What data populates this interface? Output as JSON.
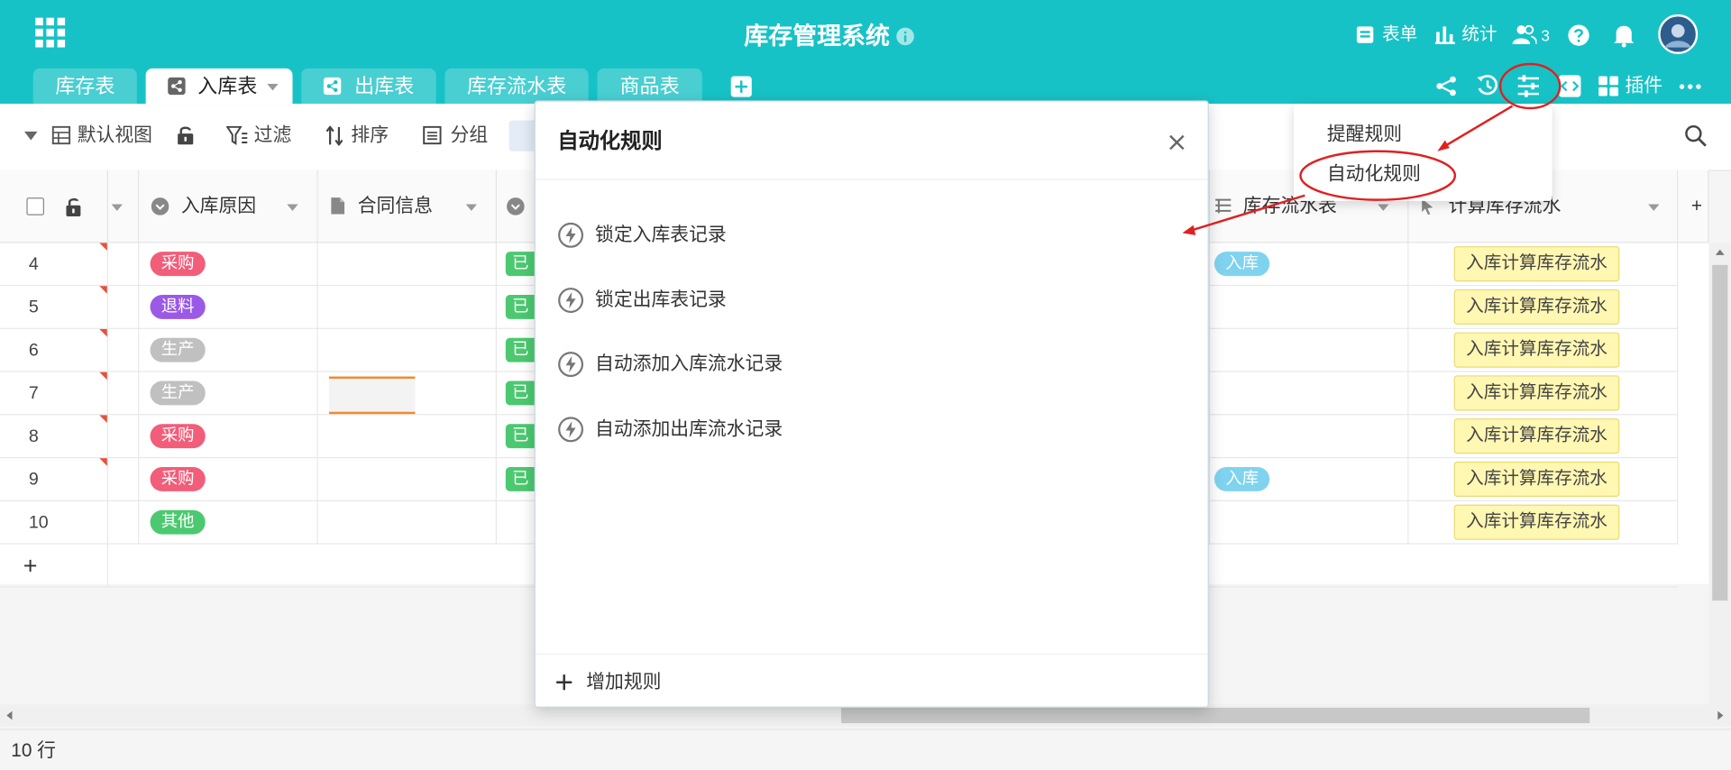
{
  "app": {
    "title": "库存管理系统"
  },
  "header": {
    "form_label": "表单",
    "stats_label": "统计",
    "members_count": "3"
  },
  "tabs": [
    {
      "label": "库存表"
    },
    {
      "label": "入库表"
    },
    {
      "label": "出库表"
    },
    {
      "label": "库存流水表"
    },
    {
      "label": "商品表"
    }
  ],
  "right_tools": {
    "plugins_label": "插件"
  },
  "toolbar": {
    "view_label": "默认视图",
    "filter_label": "过滤",
    "sort_label": "排序",
    "group_label": "分组"
  },
  "grid": {
    "columns": [
      {
        "label": "入库原因"
      },
      {
        "label": "合同信息"
      },
      {
        "label": "库存流水表"
      },
      {
        "label": "计算库存流水"
      }
    ],
    "rows": [
      {
        "num": "4",
        "reason": "采购",
        "reason_color": "#f25d7a",
        "flow": "入库",
        "calc": "入库计算库存流水"
      },
      {
        "num": "5",
        "reason": "退料",
        "reason_color": "#9b59e6",
        "flow": "",
        "calc": "入库计算库存流水"
      },
      {
        "num": "6",
        "reason": "生产",
        "reason_color": "#c0c0c0",
        "flow": "",
        "calc": "入库计算库存流水"
      },
      {
        "num": "7",
        "reason": "生产",
        "reason_color": "#c0c0c0",
        "flow": "",
        "calc": "入库计算库存流水"
      },
      {
        "num": "8",
        "reason": "采购",
        "reason_color": "#f25d7a",
        "flow": "",
        "calc": "入库计算库存流水"
      },
      {
        "num": "9",
        "reason": "采购",
        "reason_color": "#f25d7a",
        "flow": "入库",
        "calc": "入库计算库存流水"
      },
      {
        "num": "10",
        "reason": "其他",
        "reason_color": "#4cc970",
        "flow": "",
        "calc": "入库计算库存流水"
      }
    ],
    "partial_tag": "已",
    "add_row_symbol": "+"
  },
  "status": {
    "row_count": "10 行"
  },
  "modal": {
    "title": "自动化规则",
    "rules": [
      {
        "label": "锁定入库表记录"
      },
      {
        "label": "锁定出库表记录"
      },
      {
        "label": "自动添加入库流水记录"
      },
      {
        "label": "自动添加出库流水记录"
      }
    ],
    "add_label": "增加规则"
  },
  "dropdown": {
    "items": [
      {
        "label": "提醒规则"
      },
      {
        "label": "自动化规则"
      }
    ]
  },
  "colors": {
    "header_bg": "#17c2c6",
    "annotation_red": "#e02020",
    "flow_pill": "#7fd3ee",
    "calc_chip_bg": "#fff7b2"
  },
  "icons": [
    "apps-grid-icon",
    "info-icon",
    "form-icon",
    "bar-chart-icon",
    "users-icon",
    "help-icon",
    "bell-icon",
    "avatar",
    "share-icon",
    "history-icon",
    "settings-sliders-icon",
    "code-icon",
    "plugins-icon",
    "more-icon",
    "search-icon",
    "lightning-icon",
    "close-icon",
    "plus-icon"
  ]
}
